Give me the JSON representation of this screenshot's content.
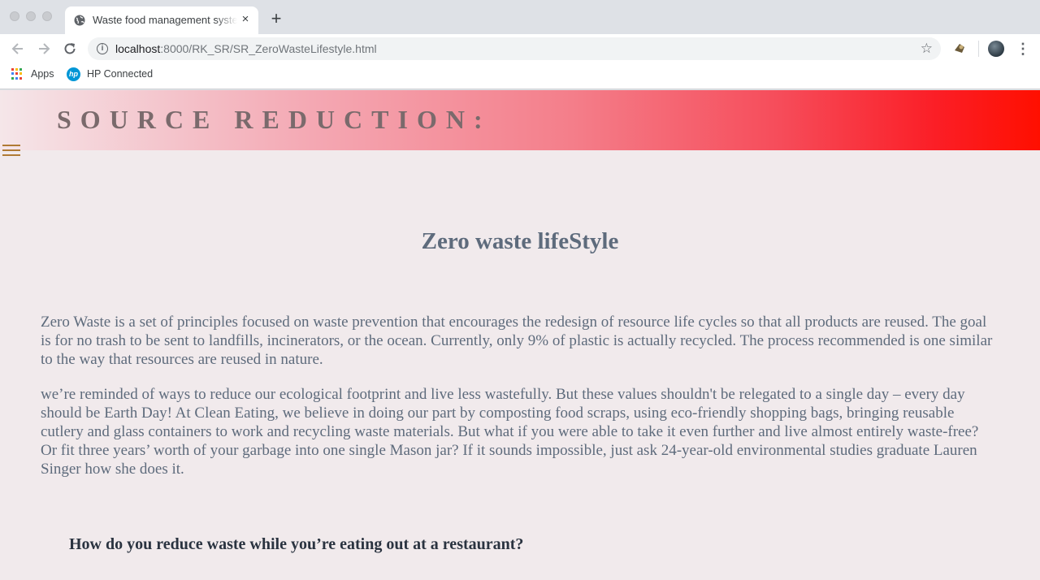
{
  "browser": {
    "tab_title": "Waste food management system",
    "tab_close": "×",
    "new_tab": "+",
    "url_host": "localhost",
    "url_path": ":8000/RK_SR/SR_ZeroWasteLifestyle.html",
    "bookmarks": [
      {
        "label": "Apps",
        "icon": "apps-grid-icon"
      },
      {
        "label": "HP Connected",
        "icon": "hp-logo-icon"
      }
    ],
    "icons": [
      "back-arrow-icon",
      "forward-arrow-icon",
      "reload-icon",
      "info-icon",
      "star-icon",
      "extension-icon",
      "avatar",
      "menu-dots-icon"
    ]
  },
  "page": {
    "banner_title": "SOURCE REDUCTION:",
    "heading": "Zero waste lifeStyle",
    "paragraph_1": "Zero Waste is a set of principles focused on waste prevention that encourages the redesign of resource life cycles so that all products are reused. The goal is for no trash to be sent to landfills, incinerators, or the ocean. Currently, only 9% of plastic is actually recycled. The process recommended is one similar to the way that resources are reused in nature.",
    "paragraph_2": "we’re reminded of ways to reduce our ecological footprint and live less wastefully. But these values shouldn't be relegated to a single day – every day should be Earth Day! At Clean Eating, we believe in doing our part by composting food scraps, using eco-friendly shopping bags, bringing reusable cutlery and glass containers to work and recycling waste materials. But what if you were able to take it even further and live almost entirely waste-free? Or fit three years’ worth of your garbage into one single Mason jar? If it sounds impossible, just ask 24-year-old environmental studies graduate Lauren Singer how she does it.",
    "subheading": "How do you reduce waste while you’re eating out at a restaurant?"
  },
  "colors": {
    "banner_gradient_start": "#f5e6e9",
    "banner_gradient_end": "#ff0f00",
    "page_background": "#f1eaec",
    "text": "#5e6b7c",
    "hamburger": "#b07a34"
  }
}
